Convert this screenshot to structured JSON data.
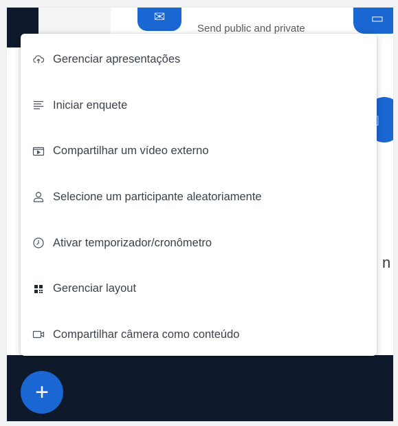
{
  "background": {
    "send_text": "Send public and private",
    "partial_text": "n",
    "fab_label": "+"
  },
  "menu": {
    "items": [
      {
        "label": "Gerenciar apresentações",
        "icon": "cloud-upload-icon"
      },
      {
        "label": "Iniciar enquete",
        "icon": "poll-list-icon"
      },
      {
        "label": "Compartilhar um vídeo externo",
        "icon": "external-video-icon"
      },
      {
        "label": "Selecione um participante aleatoriamente",
        "icon": "user-icon"
      },
      {
        "label": "Ativar temporizador/cronômetro",
        "icon": "timer-icon"
      },
      {
        "label": "Gerenciar layout",
        "icon": "layout-icon"
      },
      {
        "label": "Compartilhar câmera como conteúdo",
        "icon": "camera-icon"
      }
    ]
  },
  "colors": {
    "accent_blue": "#1a66d2",
    "dark_bar": "#0e1a2b",
    "menu_text": "#3b4249"
  }
}
